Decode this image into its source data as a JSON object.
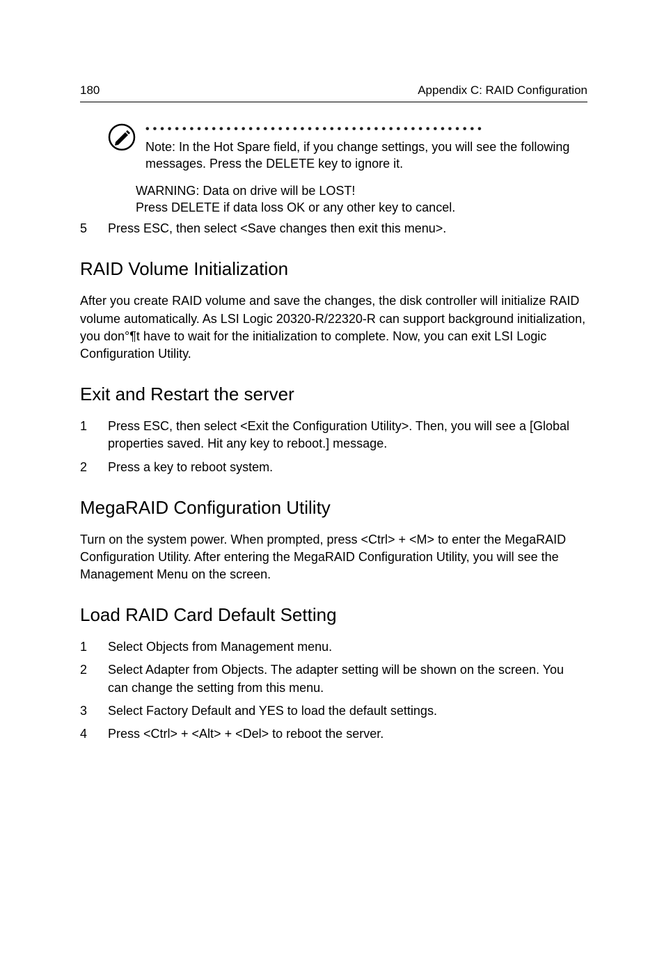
{
  "header": {
    "page_number": "180",
    "title": "Appendix C: RAID Configuration"
  },
  "note": {
    "dots": "••••••••••••••••••••••••••••••••••••••••••••••",
    "text": "Note: In the Hot Spare field, if you change settings, you will see the following messages. Press the DELETE key to ignore it."
  },
  "warning": {
    "line1": "WARNING: Data on drive will be LOST!",
    "line2": "Press DELETE if data loss OK or any other key to cancel."
  },
  "step5": {
    "num": "5",
    "text": "Press ESC, then select <Save changes then exit this menu>."
  },
  "sections": {
    "raid_init": {
      "heading": "RAID Volume Initialization",
      "body": "After you create RAID volume and save the changes, the disk controller will initialize RAID volume automatically. As LSI Logic 20320-R/22320-R can support background initialization, you don°¶t have to wait for the initialization to complete. Now, you can exit LSI Logic Configuration Utility."
    },
    "exit_restart": {
      "heading": "Exit and Restart the server",
      "items": [
        {
          "num": "1",
          "text": "Press ESC, then select <Exit the Configuration Utility>. Then, you will see a [Global properties saved. Hit any key to reboot.] message."
        },
        {
          "num": "2",
          "text": "Press a key to reboot system."
        }
      ]
    },
    "megaraid": {
      "heading": "MegaRAID Configuration Utility",
      "body": "Turn on the system power. When prompted, press <Ctrl> + <M> to enter the MegaRAID Configuration Utility. After entering the MegaRAID Configuration Utility, you will see the Management Menu on the screen."
    },
    "load_raid": {
      "heading": "Load RAID Card Default Setting",
      "items": [
        {
          "num": "1",
          "text": "Select Objects from Management menu."
        },
        {
          "num": "2",
          "text": "Select Adapter from Objects. The adapter setting will be shown on the screen. You can change the setting from this menu."
        },
        {
          "num": "3",
          "text": "Select Factory Default and YES to load the default settings."
        },
        {
          "num": "4",
          "text": "Press <Ctrl> + <Alt> + <Del> to reboot the server."
        }
      ]
    }
  }
}
